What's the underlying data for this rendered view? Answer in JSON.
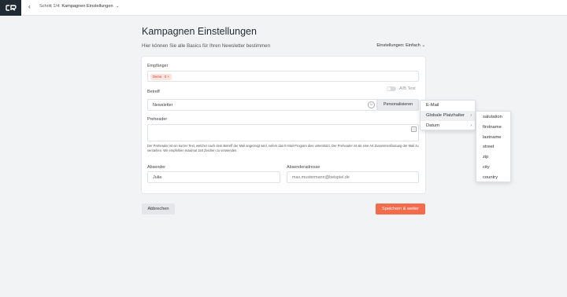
{
  "header": {
    "step": "Schritt 1/4:",
    "title": "Kampagnen Einstellungen",
    "back_icon": "chevron-left-icon",
    "dropdown_icon": "chevron-down-icon"
  },
  "page": {
    "title": "Kampagnen Einstellungen",
    "subtitle": "Hier können Sie alle Basics für Ihren Newsletter bestimmen",
    "settings_mode": "Einstellungen: Einfach"
  },
  "form": {
    "recipients": {
      "label": "Empfänger",
      "chip": "Demo · 0 ×"
    },
    "ab_test": {
      "label": "A/B Test",
      "enabled": false
    },
    "subject": {
      "label": "Betreff",
      "value": "Newsletter",
      "personalize_label": "Personalisieren"
    },
    "preheader": {
      "label": "Preheader",
      "value": "",
      "help": "Der Preheader ist ein kurzer Text, welcher nach dem Betreff der Mail angezeigt wird, sofern das E-Mail-Program dies unterstützt. Der Preheader ist als eine Art Zusammenfassung der Mail zu verstehen. Wir empfehlen maximal 150 Zeichen zu verwenden."
    },
    "sender": {
      "label": "Absender",
      "value": "Julia"
    },
    "sender_address": {
      "label": "Absenderadresse",
      "value": "max.mustermann@beispiel.de"
    }
  },
  "actions": {
    "cancel_label": "Abbrechen",
    "save_label": "Speichern & weiter"
  },
  "personalize_menu": {
    "items": [
      {
        "label": "E-Mail",
        "arrow": ""
      },
      {
        "label": "Globale Platzhalter",
        "arrow": "›"
      },
      {
        "label": "Datum",
        "arrow": "›"
      }
    ]
  },
  "placeholder_submenu": {
    "items": [
      "salutation",
      "firstname",
      "lastname",
      "street",
      "zip",
      "city",
      "country"
    ]
  },
  "colors": {
    "accent": "#f26b4b",
    "logo_bg": "#1f2a33",
    "chip_bg": "#fde4dd",
    "chip_text": "#c0392b"
  }
}
